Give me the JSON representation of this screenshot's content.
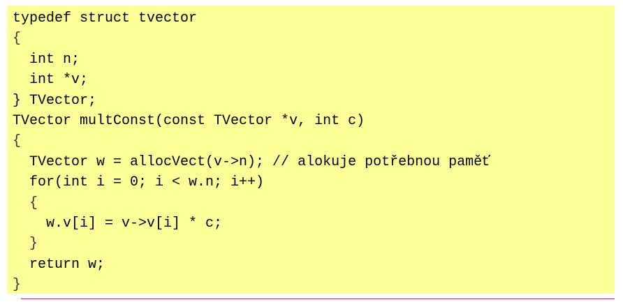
{
  "code": {
    "lines": [
      "typedef struct tvector",
      "{",
      "int n;",
      "int *v;",
      "} TVector;",
      "TVector multConst(const TVector *v, int c)",
      "{",
      "TVector w = allocVect(v->n); // alokuje potřebnou paměť",
      "for(int i = 0; i < w.n; i++)",
      "{",
      "w.v[i] = v->v[i] * c;",
      "}",
      "return w;",
      "}"
    ],
    "background_color": "#ffff99",
    "text_color": "#000000"
  },
  "colors": {
    "rule": "#b0208e"
  }
}
